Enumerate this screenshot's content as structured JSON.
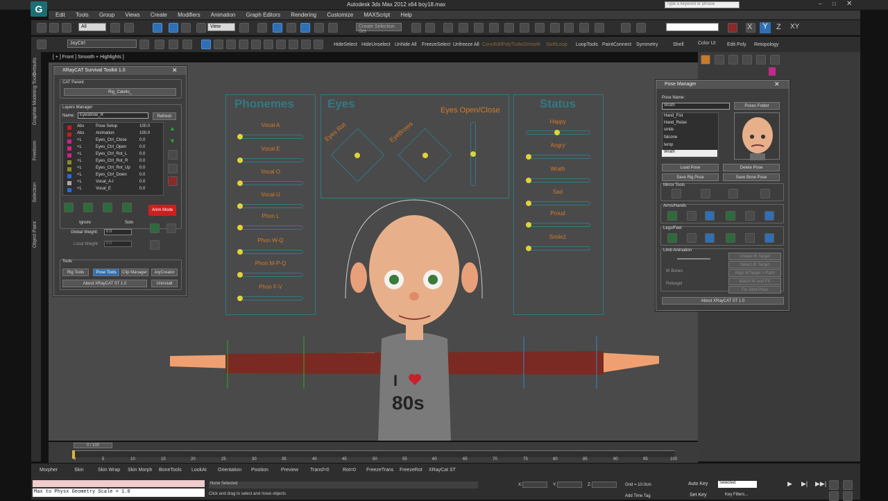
{
  "app": {
    "title": "Autodesk 3ds Max 2012 x64       boy18.max",
    "search_placeholder": "Type a keyword or phrase"
  },
  "menu": [
    "Edit",
    "Tools",
    "Group",
    "Views",
    "Create",
    "Modifiers",
    "Animation",
    "Graph Editors",
    "Rendering",
    "Customize",
    "MAXScript",
    "Help"
  ],
  "toolbar": {
    "selection_filter": "All",
    "view": "View",
    "named_sel": "Create Selection Set",
    "axis": [
      "X",
      "Y",
      "Z",
      "XY"
    ]
  },
  "toolbar2": {
    "layer": "JoyCtrl",
    "buttons": [
      "HideSelect",
      "HideUnselect",
      "Unhide All",
      "FreezeSelect",
      "Unfreeze All",
      "ConvEditPoly",
      "TurboSmooth",
      "SwiftLoop",
      "LoopTools",
      "PaintConnect",
      "Symmetry",
      "Shell",
      "Edit Poly",
      "Retopology"
    ],
    "cmd_tab": "Color UI"
  },
  "left_tabs": [
    "Graphite Modeling Tools",
    "Freeform",
    "Selection",
    "Object Paint",
    "Defaults"
  ],
  "viewport": {
    "label": "[ + ] Front ] Smooth + Highlights ]"
  },
  "toolkit": {
    "title": "XRayCAT Survival Toolkit 1.0",
    "cat_parent_label": "CAT Parent",
    "cat_parent_value": "Rig_Calello_",
    "layers_label": "Layers Manager",
    "name_label": "Name:",
    "name_value": "Eyesbrow_R",
    "refresh": "Refresh",
    "layers": [
      {
        "t": "Abs",
        "n": "Pose Setup",
        "v": "100.0",
        "c": "#c02020"
      },
      {
        "t": "Abs",
        "n": "Animation",
        "v": "100.0",
        "c": "#c02020"
      },
      {
        "t": "+L",
        "n": "Eyes_Ctrl_Close",
        "v": "0.0",
        "c": "#cc2288"
      },
      {
        "t": "+L",
        "n": "Eyes_Ctrl_Open",
        "v": "0.0",
        "c": "#cc2288"
      },
      {
        "t": "+L",
        "n": "Eyes_Ctrl_Rot_L",
        "v": "0.0",
        "c": "#cc2288"
      },
      {
        "t": "+L",
        "n": "Eyes_Ctrl_Rot_R",
        "v": "0.0",
        "c": "#8a8a2a"
      },
      {
        "t": "+L",
        "n": "Eyes_Ctrl_Rot_Up",
        "v": "0.0",
        "c": "#8a8a2a"
      },
      {
        "t": "+L",
        "n": "Eyes_Ctrl_Down",
        "v": "0.0",
        "c": "#2a6acc"
      },
      {
        "t": "+L",
        "n": "Vocal_A-I",
        "v": "0.0",
        "c": "#aaaaaa"
      },
      {
        "t": "+L",
        "n": "Vocal_E",
        "v": "0.0",
        "c": "#2a6acc"
      }
    ],
    "anim_mode": "Anim Mode",
    "ignore": "Ignore",
    "solo": "Solo",
    "global_weight": "Global Weight:",
    "global_weight_val": "0.0",
    "local_weight": "Local Weight:",
    "local_weight_val": "0.0",
    "tools_label": "Tools",
    "tools": [
      "Rig Tools",
      "Pose Tools",
      "Clip Manager",
      "JoyCreator"
    ],
    "about": "About XRayCAT ST 1.0",
    "uninstall": "Uninstall"
  },
  "joystick": {
    "phonemes_title": "Phonemes",
    "eyes_title": "Eyes",
    "status_title": "Status",
    "eyes_openclose": "Eyes Open/Close",
    "eyes_rot": "Eyes Rot",
    "eyebrows": "EyeBrows",
    "phonemes": [
      "Vocal A",
      "Vocal E",
      "Vocal O",
      "Vocal U",
      "Phon L",
      "Phon W-Q",
      "Phon M-P-Q",
      "Phon F-V"
    ],
    "status": [
      "Happy",
      "Angry",
      "Wrath",
      "Sad",
      "Proud",
      "Smile1"
    ]
  },
  "shirt": {
    "line1": "I",
    "line2": "80s"
  },
  "pose_manager": {
    "title": "Pose Manager",
    "pose_name_label": "Pose Name:",
    "pose_name": "Wrath",
    "poses_folder": "Poses Folder",
    "poses": [
      "Hand_Fist",
      "Hand_Relax",
      "smile",
      "falcone",
      "temp",
      "Wrath"
    ],
    "load": "Load Pose",
    "delete": "Delete Pose",
    "save_rig": "Save Rig Pose",
    "save_bone": "Save Bone Pose",
    "mirror": "Mirror Tools",
    "arms": "Arms/Hands",
    "legs": "Legs/Feet",
    "limb": "Limb Animation",
    "ik_bones": "IK Bones",
    "relaxgel": "Relaxgel",
    "ik_buttons": [
      "Create IK Target",
      "Select IK Target",
      "Align IKTarget > Palm",
      "Match IK and FK",
      "Fix Joint Pose"
    ],
    "about": "About XRayCAT ST 1.0"
  },
  "timeline": {
    "frame": "0 / 100",
    "ticks": [
      "0",
      "5",
      "10",
      "15",
      "20",
      "25",
      "30",
      "35",
      "40",
      "45",
      "50",
      "55",
      "60",
      "65",
      "70",
      "75",
      "80",
      "85",
      "90",
      "95",
      "100"
    ]
  },
  "bottom": {
    "shelf": [
      "Morpher",
      "Skin",
      "Skin Wrap",
      "Skin Morph",
      "BoneTools",
      "LookAt",
      "Orientation",
      "Position",
      "Preview",
      "Transf=0",
      "Rot=0",
      "FreezeTrans",
      "FreezeRot",
      "XRayCat ST"
    ],
    "maxscript": "Max to Physx Geometry Scale = 1.0",
    "status1": "None Selected",
    "status2": "Click and drag to select and move objects",
    "grid": "Grid = 10.0cm",
    "autokey": "Auto Key",
    "setkey": "Set Key",
    "selected": "Selected",
    "keyfilters": "Key Filters...",
    "addtimetag": "Add Time Tag",
    "coord_x": "X:",
    "coord_y": "Y:",
    "coord_z": "Z:"
  }
}
